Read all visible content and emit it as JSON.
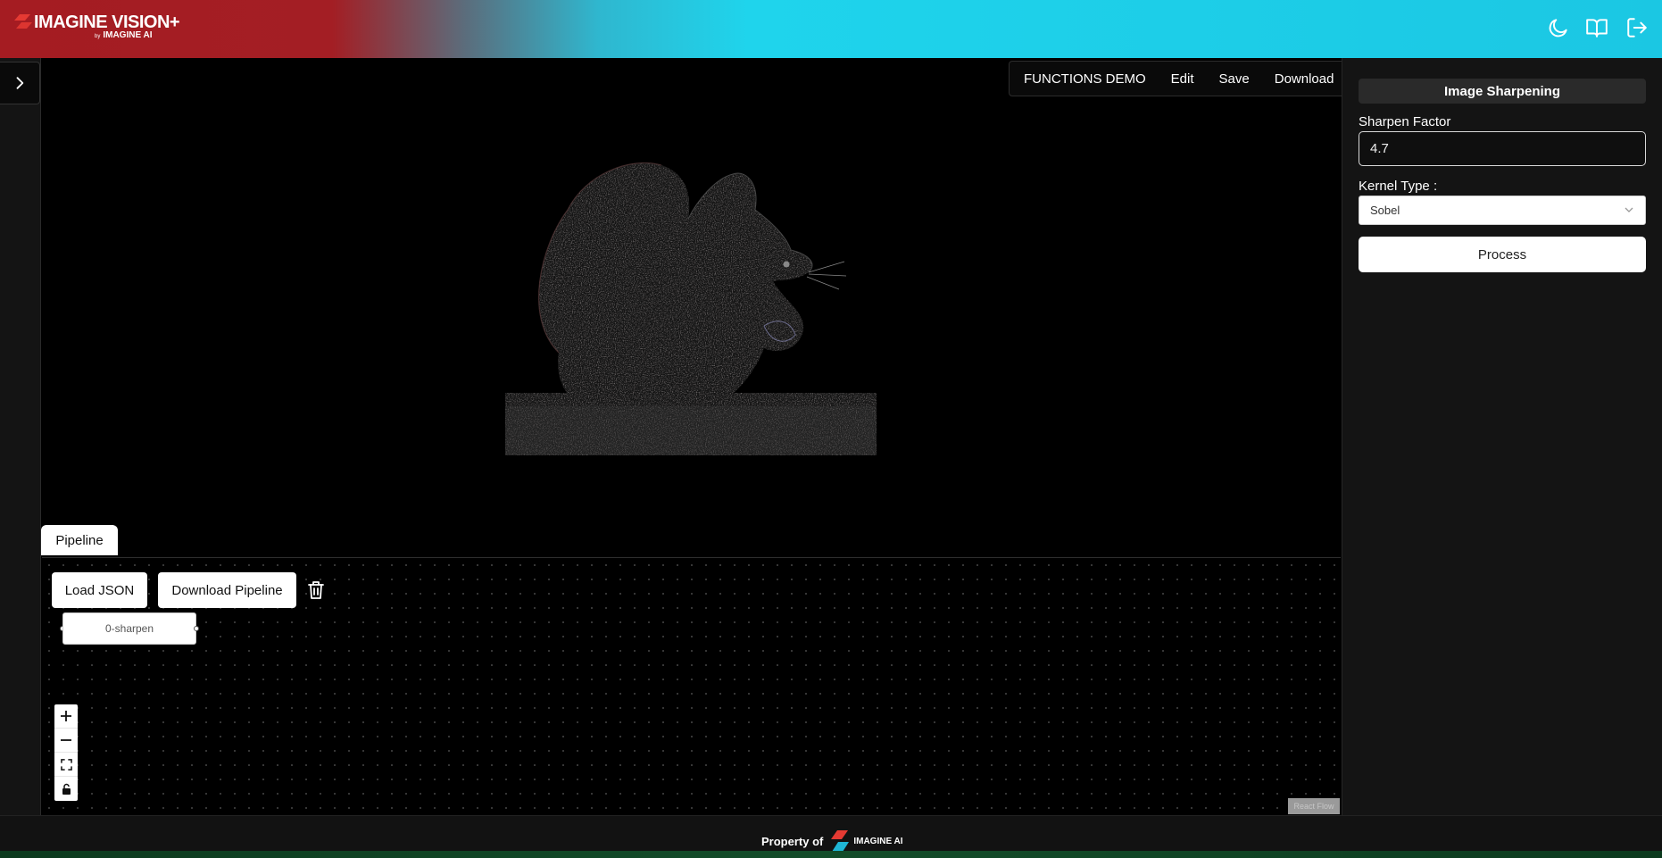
{
  "header": {
    "logo_title": "IMAGINE VISION+",
    "logo_by": "by",
    "logo_sub": "IMAGINE AI",
    "icons": [
      "moon-icon",
      "book-open-icon",
      "logout-icon"
    ]
  },
  "sidebar": {
    "toggle_icon": "chevron-right-icon"
  },
  "topmenu": {
    "items": [
      "FUNCTIONS DEMO",
      "Edit",
      "Save",
      "Download"
    ]
  },
  "preview": {
    "subject": "edge-detected squirrel image"
  },
  "pipeline": {
    "tab_label": "Pipeline",
    "load_json_label": "Load JSON",
    "download_pipeline_label": "Download Pipeline",
    "node_label": "0-sharpen",
    "zoom_controls": [
      "zoom-in-icon",
      "zoom-out-icon",
      "fit-view-icon",
      "lock-icon"
    ],
    "attribution": "React Flow"
  },
  "panel": {
    "title": "Image Sharpening",
    "sharpen_label": "Sharpen Factor",
    "sharpen_value": "4.7",
    "kernel_label": "Kernel Type :",
    "kernel_value": "Sobel",
    "process_label": "Process"
  },
  "footer": {
    "property_text": "Property of",
    "brand": "IMAGINE AI"
  },
  "colors": {
    "header_red": "#a51c22",
    "header_cyan": "#1fd4ec",
    "panel_bg": "#141414",
    "canvas_bg": "#000000"
  }
}
